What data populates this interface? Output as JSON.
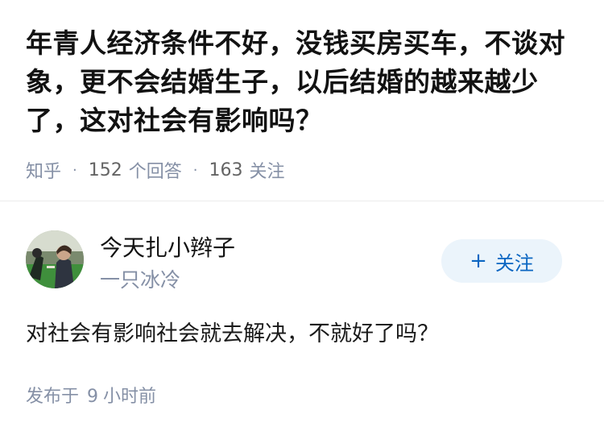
{
  "question": {
    "title": "年青人经济条件不好，没钱买房买车，不谈对象，更不会结婚生子，以后结婚的越来越少了，这对社会有影响吗？",
    "source": "知乎",
    "separator": "·",
    "answer_count": "152",
    "answer_label": "个回答",
    "follower_count": "163",
    "follower_label": "关注"
  },
  "author": {
    "name": "今天扎小辫子",
    "headline": "一只冰冷",
    "avatar_icon": "avatar-photo",
    "follow_plus": "+",
    "follow_label": "关注"
  },
  "answer": {
    "text": "对社会有影响社会就去解决，不就好了吗？",
    "published_prefix": "发布于",
    "published_num": "9",
    "published_unit": "小时前"
  },
  "colors": {
    "title": "#121212",
    "meta": "#8590a6",
    "follow_bg": "#ebf4fb",
    "follow_text": "#0b66c2"
  }
}
